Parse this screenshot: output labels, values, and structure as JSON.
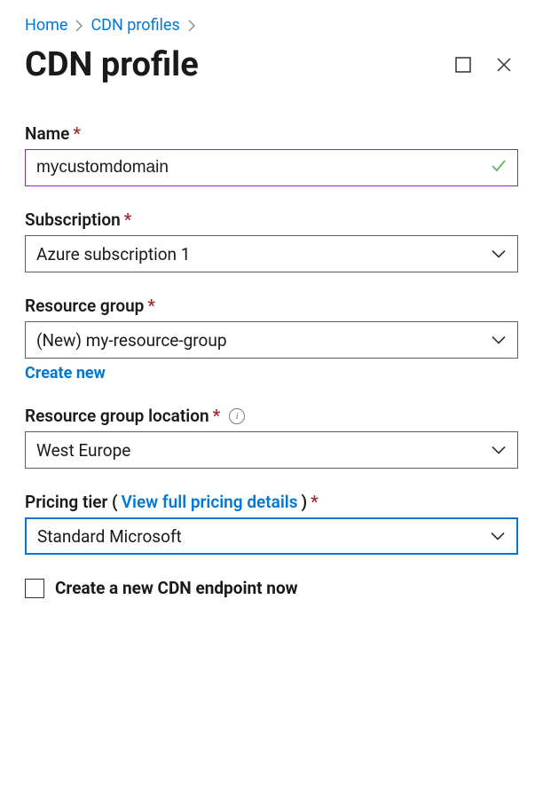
{
  "breadcrumb": {
    "home": "Home",
    "profiles": "CDN profiles"
  },
  "title": "CDN profile",
  "fields": {
    "name": {
      "label": "Name",
      "value": "mycustomdomain"
    },
    "subscription": {
      "label": "Subscription",
      "value": "Azure subscription 1"
    },
    "resource_group": {
      "label": "Resource group",
      "value": "(New) my-resource-group",
      "create_new": "Create new"
    },
    "location": {
      "label": "Resource group location",
      "value": "West Europe"
    },
    "pricing": {
      "label_prefix": "Pricing tier (",
      "link": "View full pricing details",
      "label_suffix": ")",
      "value": "Standard Microsoft"
    }
  },
  "checkbox": {
    "label": "Create a new CDN endpoint now"
  }
}
